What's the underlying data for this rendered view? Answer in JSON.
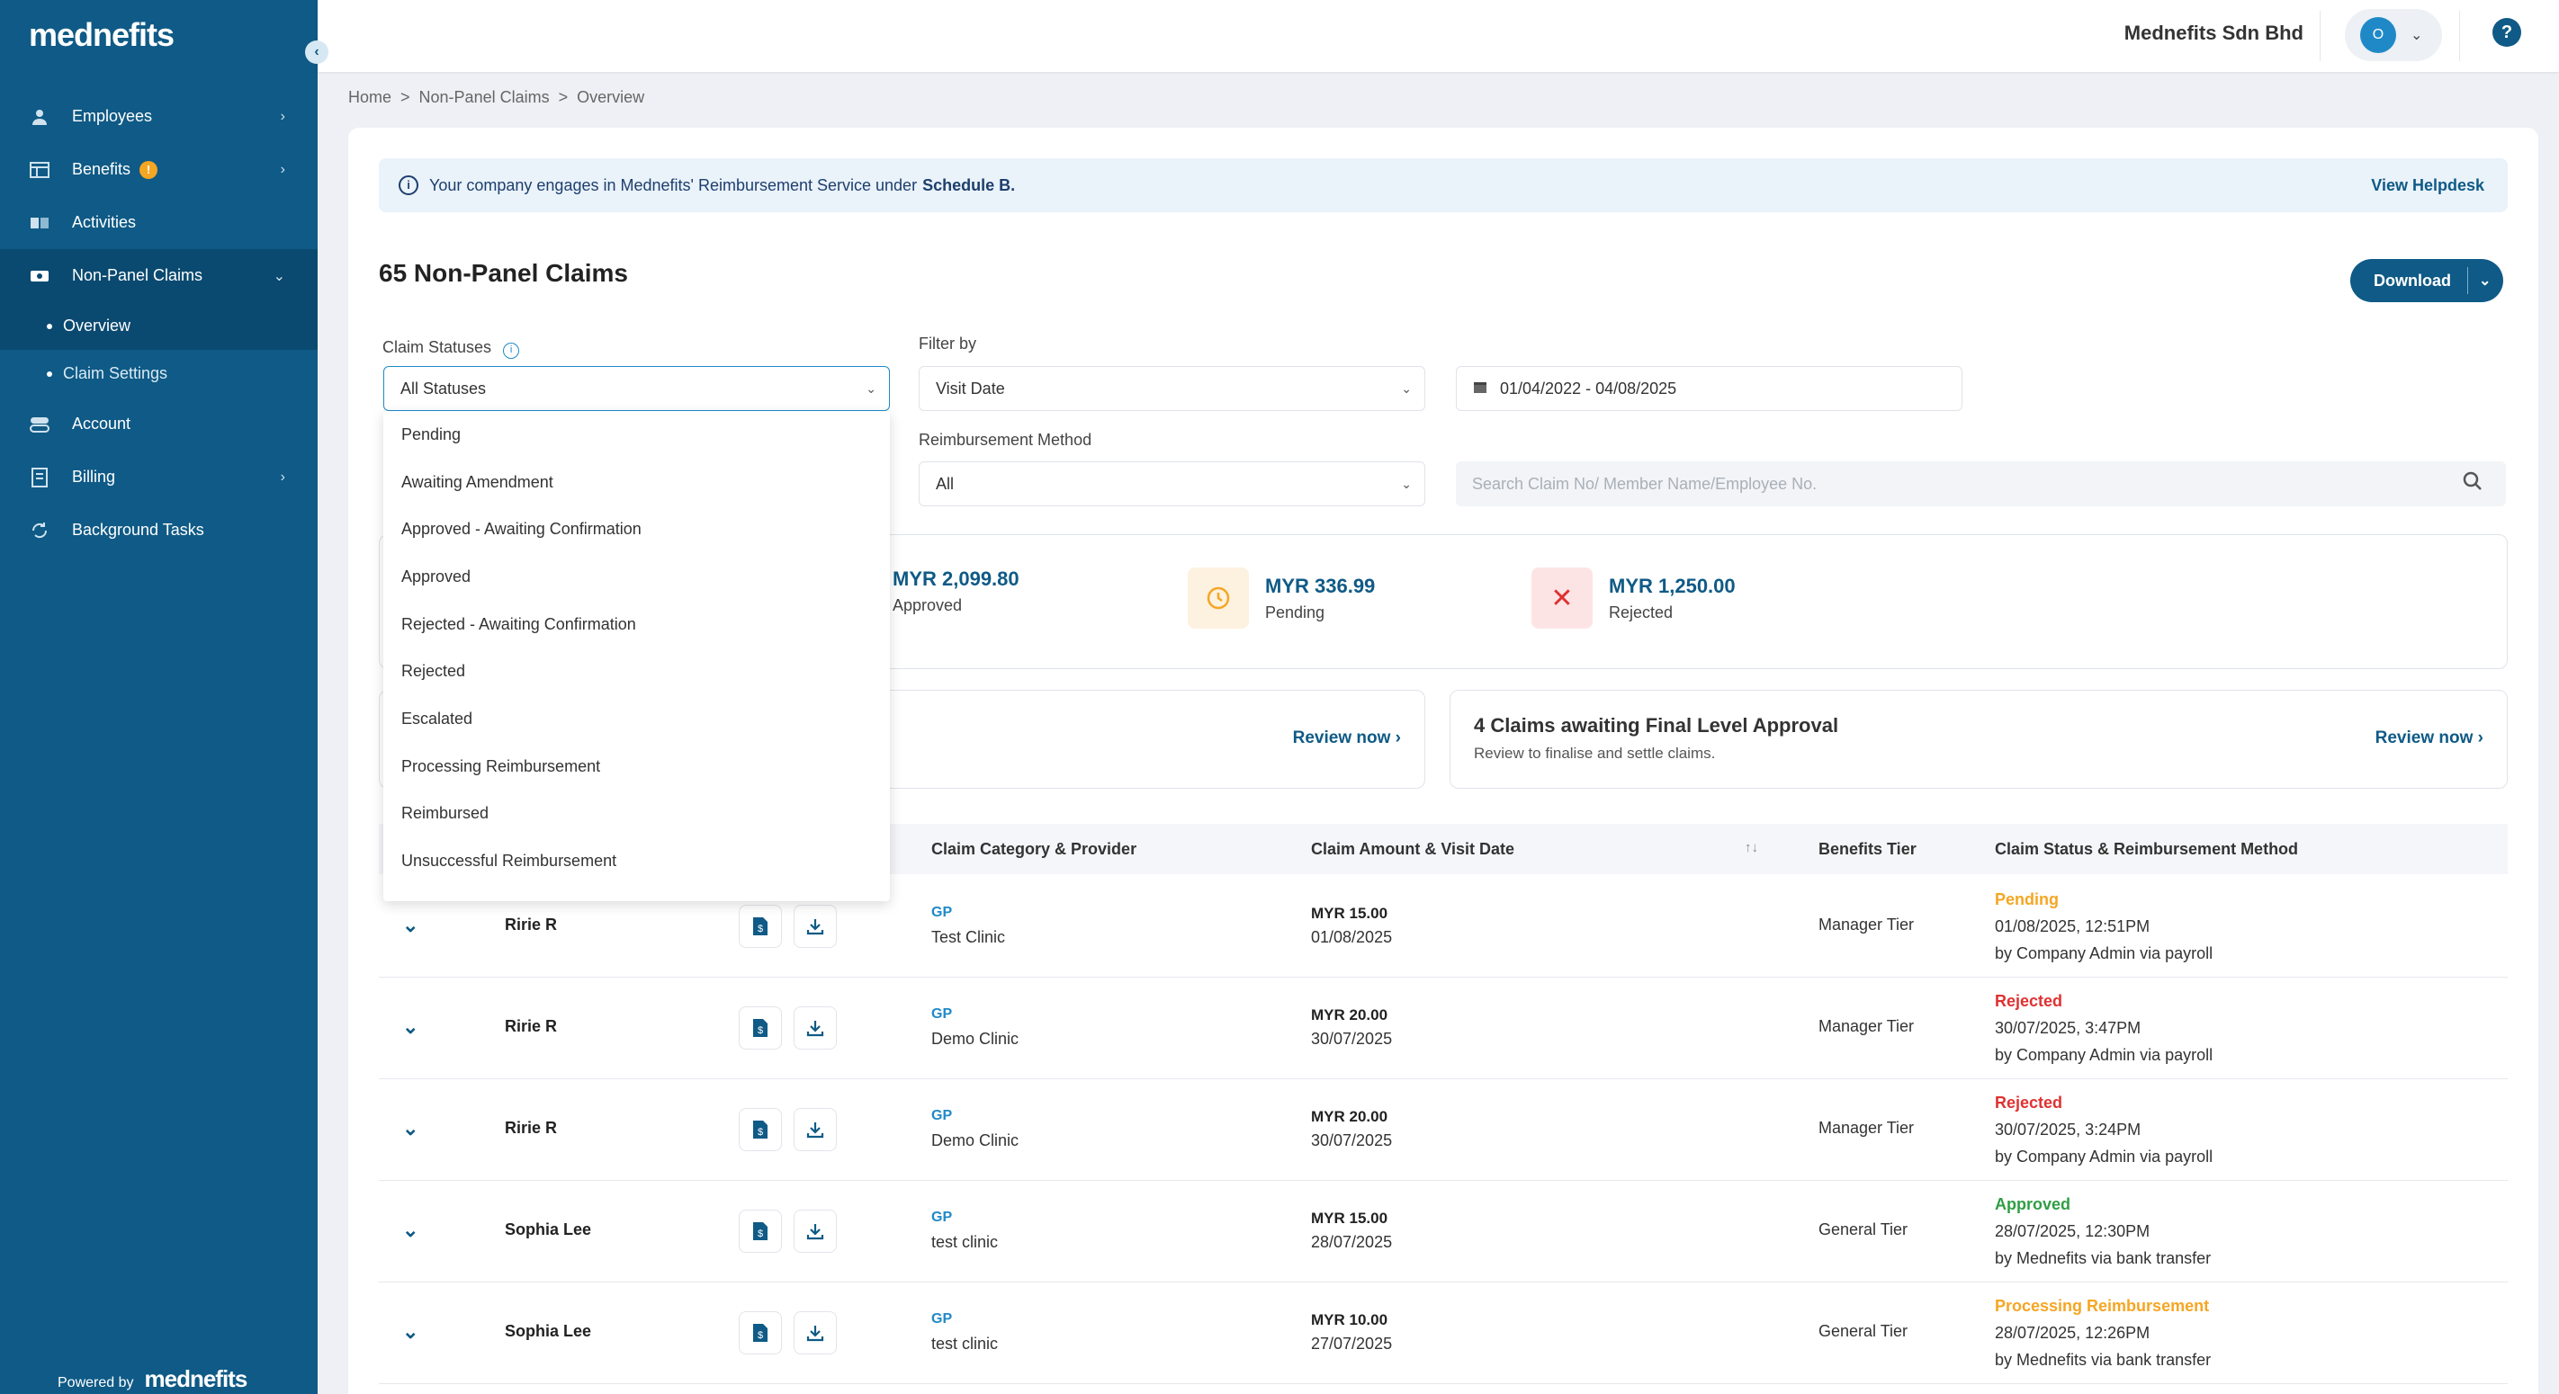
{
  "sidebar": {
    "logo": "mednefits",
    "items": [
      {
        "label": "Employees"
      },
      {
        "label": "Benefits",
        "badge": "!"
      },
      {
        "label": "Activities"
      },
      {
        "label": "Non-Panel Claims"
      },
      {
        "label": "Account"
      },
      {
        "label": "Billing"
      },
      {
        "label": "Background Tasks"
      }
    ],
    "subitems": [
      {
        "label": "Overview"
      },
      {
        "label": "Claim Settings"
      }
    ],
    "powered_by": "Powered by",
    "powered_logo": "mednefits"
  },
  "topbar": {
    "company": "Mednefits Sdn Bhd",
    "avatar_initial": "O",
    "help": "?"
  },
  "breadcrumb": [
    "Home",
    ">",
    "Non-Panel Claims",
    ">",
    "Overview"
  ],
  "info": {
    "text": "Your company engages in Mednefits' Reimbursement Service under",
    "schedule": "Schedule B.",
    "helpdesk": "View Helpdesk"
  },
  "page": {
    "title": "65 Non-Panel Claims",
    "download": "Download"
  },
  "filters": {
    "claim_statuses_label": "Claim Statuses",
    "claim_statuses_value": "All Statuses",
    "filter_by_label": "Filter by",
    "filter_by_value": "Visit Date",
    "date_range": "01/04/2022 - 04/08/2025",
    "reimb_method_label": "Reimbursement Method",
    "reimb_method_value": "All",
    "search_placeholder": "Search Claim No/ Member Name/Employee No."
  },
  "dropdown_options": [
    "Pending",
    "Awaiting Amendment",
    "Approved - Awaiting Confirmation",
    "Approved",
    "Rejected - Awaiting Confirmation",
    "Rejected",
    "Escalated",
    "Processing Reimbursement",
    "Reimbursed",
    "Unsuccessful Reimbursement"
  ],
  "summary": [
    {
      "amount": "MYR 2,099.80",
      "label": "Approved"
    },
    {
      "amount": "MYR 336.99",
      "label": "Pending"
    },
    {
      "amount": "MYR 1,250.00",
      "label": "Rejected"
    }
  ],
  "actions": [
    {
      "review": "Review now"
    },
    {
      "title": "4 Claims awaiting Final Level Approval",
      "subtitle": "Review to finalise and settle claims.",
      "review": "Review now"
    }
  ],
  "table": {
    "headers": [
      "Claim Category & Provider",
      "Claim Amount & Visit Date",
      "Benefits Tier",
      "Claim Status & Reimbursement Method"
    ],
    "rows": [
      {
        "name": "Ririe R",
        "category": "GP",
        "provider": "Test Clinic",
        "amount": "MYR 15.00",
        "visit_date": "01/08/2025",
        "tier": "Manager Tier",
        "status": "Pending",
        "status_color": "#f5a623",
        "status_date": "01/08/2025, 12:51PM",
        "status_by": "by Company Admin via payroll"
      },
      {
        "name": "Ririe R",
        "category": "GP",
        "provider": "Demo Clinic",
        "amount": "MYR 20.00",
        "visit_date": "30/07/2025",
        "tier": "Manager Tier",
        "status": "Rejected",
        "status_color": "#e03131",
        "status_date": "30/07/2025, 3:47PM",
        "status_by": "by Company Admin via payroll"
      },
      {
        "name": "Ririe R",
        "category": "GP",
        "provider": "Demo Clinic",
        "amount": "MYR 20.00",
        "visit_date": "30/07/2025",
        "tier": "Manager Tier",
        "status": "Rejected",
        "status_color": "#e03131",
        "status_date": "30/07/2025, 3:24PM",
        "status_by": "by Company Admin via payroll"
      },
      {
        "name": "Sophia Lee",
        "category": "GP",
        "provider": "test clinic",
        "amount": "MYR 15.00",
        "visit_date": "28/07/2025",
        "tier": "General Tier",
        "status": "Approved",
        "status_color": "#2f9e44",
        "status_date": "28/07/2025, 12:30PM",
        "status_by": "by Mednefits via bank transfer"
      },
      {
        "name": "Sophia Lee",
        "category": "GP",
        "provider": "test clinic",
        "amount": "MYR 10.00",
        "visit_date": "27/07/2025",
        "tier": "General Tier",
        "status": "Processing Reimbursement",
        "status_color": "#f5a623",
        "status_date": "28/07/2025, 12:26PM",
        "status_by": "by Mednefits via bank transfer"
      }
    ]
  }
}
